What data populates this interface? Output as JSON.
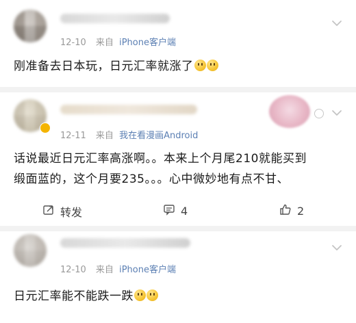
{
  "comments": [
    {
      "date": "12-10",
      "source_prefix": "来自",
      "source": "iPhone客户端",
      "text": "刚准备去日本玩，日元汇率就涨了"
    },
    {
      "date": "12-11",
      "source_prefix": "来自",
      "source": "我在看漫画Android",
      "text_line1": "话说最近日元汇率高涨啊。。本来上个月尾210就能买到",
      "text_line2": "缎面蓝的，这个月要235。。。心中微妙地有点不甘、",
      "actions": {
        "repost_label": "转发",
        "comment_count": "4",
        "like_count": "2"
      }
    },
    {
      "date": "12-10",
      "source_prefix": "来自",
      "source": "iPhone客户端",
      "text": "日元汇率能不能跌一跌"
    }
  ],
  "icons": {
    "expand": "chevron-down-icon",
    "repost": "repost-icon",
    "comment": "comment-icon",
    "like": "thumbs-up-icon",
    "emoji": "smile-emoji-icon"
  },
  "colors": {
    "link": "#5b7fb3",
    "meta": "#999999",
    "divider": "#f2f2f2"
  }
}
